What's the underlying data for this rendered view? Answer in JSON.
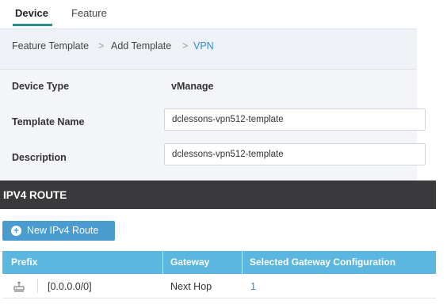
{
  "tabs": {
    "device": "Device",
    "feature": "Feature"
  },
  "breadcrumb": {
    "item1": "Feature Template",
    "item2": "Add Template",
    "item3": "VPN",
    "separator": ">"
  },
  "form": {
    "device_type_label": "Device Type",
    "device_type_value": "vManage",
    "template_name_label": "Template Name",
    "template_name_value": "dclessons-vpn512-template",
    "description_label": "Description",
    "description_value": "dclessons-vpn512-template"
  },
  "section": {
    "title": "IPV4 ROUTE"
  },
  "new_route_button": {
    "label": "New IPv4 Route",
    "icon": "plus-circle-icon"
  },
  "table": {
    "headers": [
      "Prefix",
      "Gateway",
      "Selected Gateway Configuration"
    ],
    "rows": [
      {
        "icon": "network-device-icon",
        "prefix": "[0.0.0.0/0]",
        "gateway": "Next Hop",
        "config": "1"
      }
    ]
  },
  "colors": {
    "accent_teal": "#2a8f8f",
    "link_blue": "#2a8fd1",
    "section_header_bg": "#3a3a3c",
    "button_bg": "#4a9bd0",
    "table_header_bg": "#5bb6e0"
  }
}
